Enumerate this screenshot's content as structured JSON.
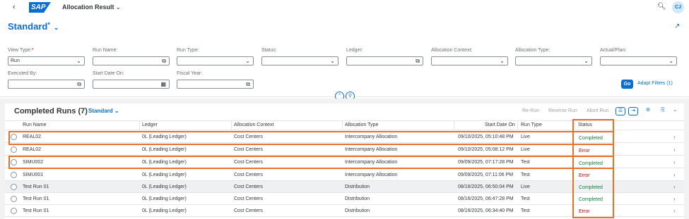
{
  "shell": {
    "back_icon": "back-arrow-icon",
    "logo_text": "SAP",
    "app_title": "Allocation Result",
    "title_chevron": "⌄",
    "avatar": "CJ"
  },
  "variant": {
    "name": "Standard",
    "dirty_marker": "*",
    "chevron": "⌄"
  },
  "filters": {
    "view_type": {
      "label": "View Type:",
      "required": "*",
      "value": "Run"
    },
    "run_name": {
      "label": "Run Name:",
      "value": ""
    },
    "run_type": {
      "label": "Run Type:",
      "value": ""
    },
    "status": {
      "label": "Status:",
      "value": ""
    },
    "ledger": {
      "label": "Ledger:",
      "value": ""
    },
    "allocation_context": {
      "label": "Allocation Context:",
      "value": ""
    },
    "allocation_type": {
      "label": "Allocation Type:",
      "value": ""
    },
    "actual_plan": {
      "label": "Actual/Plan:",
      "value": ""
    },
    "executed_by": {
      "label": "Executed By:",
      "value": ""
    },
    "start_date_on": {
      "label": "Start Date On:",
      "value": ""
    },
    "fiscal_year": {
      "label": "Fiscal Year:",
      "value": ""
    },
    "go_label": "Go",
    "adapt_label": "Adapt Filters (1)"
  },
  "table": {
    "title": "Completed Runs (7)",
    "variant": "Standard",
    "toolbar": {
      "rerun": "Re-Run",
      "reverse": "Reverse Run",
      "abort": "Abort Run"
    },
    "columns": [
      "Run Name",
      "Ledger",
      "Allocation Context",
      "Allocation Type",
      "Start Date On",
      "Run Type",
      "Status"
    ],
    "rows": [
      {
        "run_name": "REAL02",
        "ledger": "0L (Leading Ledger)",
        "context": "Cost Centers",
        "type": "Intercompany Allocation",
        "start": "09/10/2025, 05:10:48 PM",
        "run_type": "Live",
        "status": "Completed"
      },
      {
        "run_name": "REAL02",
        "ledger": "0L (Leading Ledger)",
        "context": "Cost Centers",
        "type": "Intercompany Allocation",
        "start": "09/10/2025, 05:08:12 PM",
        "run_type": "Live",
        "status": "Error"
      },
      {
        "run_name": "SIMU002",
        "ledger": "0L (Leading Ledger)",
        "context": "Cost Centers",
        "type": "Intercompany Allocation",
        "start": "09/09/2025, 07:17:28 PM",
        "run_type": "Test",
        "status": "Completed"
      },
      {
        "run_name": "SIMU001",
        "ledger": "0L (Leading Ledger)",
        "context": "Cost Centers",
        "type": "Intercompany Allocation",
        "start": "09/09/2025, 07:11:06 PM",
        "run_type": "Test",
        "status": "Error"
      },
      {
        "run_name": "Test Run 01",
        "ledger": "0L (Leading Ledger)",
        "context": "Cost Centers",
        "type": "Distribution",
        "start": "08/16/2025, 06:50:04 PM",
        "run_type": "Live",
        "status": "Completed"
      },
      {
        "run_name": "Test Run 01",
        "ledger": "0L (Leading Ledger)",
        "context": "Cost Centers",
        "type": "Distribution",
        "start": "08/16/2025, 06:47:28 PM",
        "run_type": "Test",
        "status": "Completed"
      },
      {
        "run_name": "Test Run 01",
        "ledger": "0L (Leading Ledger)",
        "context": "Cost Centers",
        "type": "Distribution",
        "start": "08/16/2025, 06:34:40 PM",
        "run_type": "Test",
        "status": "Error"
      }
    ]
  },
  "colors": {
    "accent": "#0a6ed1",
    "highlight": "#e8702a",
    "ok": "#107e3e",
    "error": "#bb0000"
  }
}
